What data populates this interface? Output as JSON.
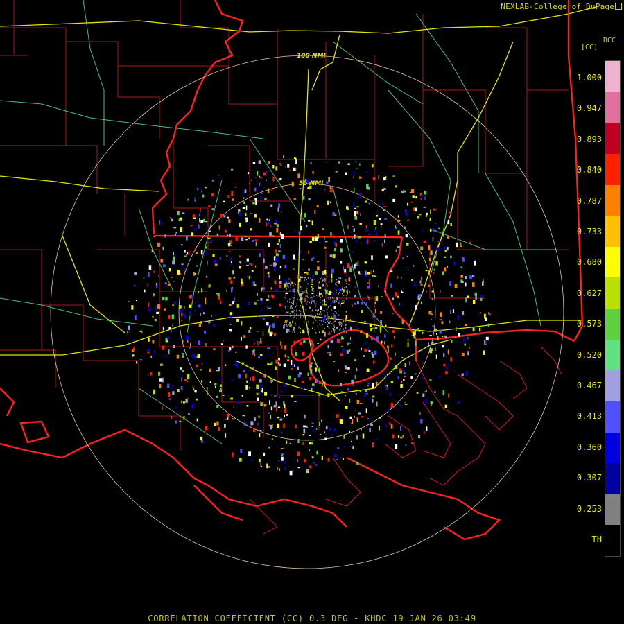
{
  "header": {
    "credit": "NEXLAB-College of DuPage",
    "product_code": "DCC",
    "unit": "[CC]"
  },
  "map": {
    "range_rings": [
      {
        "label": "100 NMI"
      },
      {
        "label": "50 NMI"
      }
    ],
    "colors": {
      "county_lines": "#a81818",
      "state_lines": "#ff2020",
      "highways": "#e6e600",
      "roads": "#4fbf7a",
      "range_rings": "#e8c8a0"
    }
  },
  "legend": {
    "ticks": [
      "1.000",
      "0.947",
      "0.893",
      "0.840",
      "0.787",
      "0.733",
      "0.680",
      "0.627",
      "0.573",
      "0.520",
      "0.467",
      "0.413",
      "0.360",
      "0.307",
      "0.253",
      "TH"
    ],
    "colors": [
      "#f0b0d0",
      "#e070a0",
      "#c00020",
      "#ff2000",
      "#ff8000",
      "#ffc000",
      "#ffff00",
      "#b8e000",
      "#60d040",
      "#60e080",
      "#a0a0e0",
      "#5050ff",
      "#0000e0",
      "#0000a0",
      "#808080",
      "#000000"
    ]
  },
  "caption": "CORRELATION COEFFICIENT (CC) 0.3 DEG - KHDC 19 JAN 26 03:49"
}
